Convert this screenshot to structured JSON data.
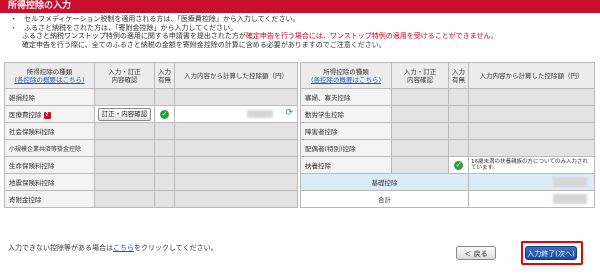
{
  "header": {
    "title": "所得控除の入力"
  },
  "notes": {
    "line1": "・　セルフメディケーション税制を適用される方は、「医療費控除」から入力してください。",
    "line2": "・　ふるさと納税をされた方は、「寄附金控除」から入力してください。",
    "line3_a": "ふるさと納税ワンストップ特例の適用に関する申請書を提出された方が",
    "line3_red": "確定申告を行う場合には、ワンストップ特例の適用を受けることができません。",
    "line4": "確定申告を行う際に、全てのふるさと納税の金額を寄附金控除の計算に含める必要がありますのでご注意ください。"
  },
  "left_table": {
    "headers": {
      "type": "所得控除の種類",
      "summary_link": "(各控除の概要はこちら)",
      "input_edit": "入力・訂正",
      "content_check": "内容確認",
      "input": "入力",
      "presence": "有無",
      "amount": "入力内容から計算した控除額（円）"
    },
    "rows": [
      {
        "label": "雑損控除"
      },
      {
        "label": "医療費控除",
        "has_help": true,
        "button": "訂正・内容確認",
        "checked": true
      },
      {
        "label": "社会保険料控除"
      },
      {
        "label": "小規模企業共済等掛金控除"
      },
      {
        "label": "生命保険料控除"
      },
      {
        "label": "地震保険料控除"
      },
      {
        "label": "寄附金控除"
      }
    ]
  },
  "right_table": {
    "headers": {
      "type": "所得控除の種類",
      "summary_link": "(各控除の概要はこちら)",
      "input_edit": "入力・訂正",
      "content_check": "内容確認",
      "input": "入力",
      "presence": "有無",
      "amount": "入力内容から計算した控除額（円）"
    },
    "rows": [
      {
        "label": "寡婦、寡夫控除"
      },
      {
        "label": "勤労学生控除"
      },
      {
        "label": "障害者控除"
      },
      {
        "label": "配偶者(特別)控除"
      },
      {
        "label": "扶養控除",
        "checked": true,
        "note": "16歳未満の扶養親族の方についてのみ入力されています。"
      }
    ],
    "basic_label": "基礎控除",
    "total_label": "合計"
  },
  "footer": {
    "note_prefix": "入力できない控除等がある場合は",
    "note_link": "こちら",
    "note_suffix": "をクリックしてください。"
  },
  "buttons": {
    "back": "＜ 戻る",
    "next": "入力終了(次へ)＞"
  }
}
